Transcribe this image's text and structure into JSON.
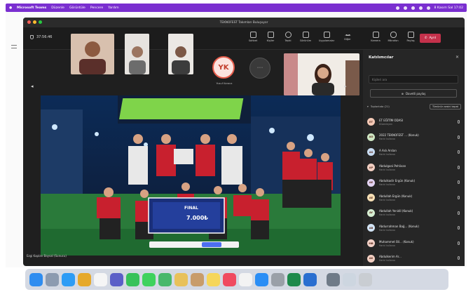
{
  "menubar": {
    "items": [
      "Microsoft Teams",
      "Düzenle",
      "Görüntüle",
      "Pencere",
      "Yardım"
    ],
    "clock": "8 Kasım Sal 17:02"
  },
  "window": {
    "title": "TEKNOFEST Takımları Buluşuyor"
  },
  "toolbar": {
    "timer": "37:56:46",
    "buttons": [
      "Sohbet",
      "Kişiler",
      "Tepki",
      "Görünüm",
      "Uygulamalar",
      "Diğer",
      "Kamera",
      "Mikrofon",
      "Paylaş"
    ],
    "leave_label": "Ayrıl"
  },
  "stage": {
    "yk_initials": "YK",
    "yk_name": "Yusuf Karaca",
    "caption": "Ezgi Kaplan Baysal (Sunucu)",
    "banner_line1": "FINAL",
    "banner_line2": "7.000₺"
  },
  "participants": {
    "title": "Katılımcılar",
    "search_placeholder": "Kişileri ara",
    "share_label": "Davetli paylaş",
    "section_label": "Toplantıda (21)",
    "mute_all": "Tümünün sesini kapat",
    "list": [
      {
        "initials": "ET",
        "name": "ET EĞİTİM ODASI",
        "role": "Düzenleyen",
        "color": "#f4c9b6"
      },
      {
        "initials": "AO",
        "name": "2022 TEKNOFEST ... (Konuk)",
        "role": "Harici kullanıcı",
        "color": "#cfe7c4"
      },
      {
        "initials": "AS",
        "name": "A Aslı Arslan",
        "role": "Harici kullanıcı",
        "color": "#c9dcf2"
      },
      {
        "initials": "AP",
        "name": "Abdulgani Pehlivan",
        "role": "Harici kullanıcı",
        "color": "#f2cfc2"
      },
      {
        "initials": "AE",
        "name": "Abdulkadir Ergün (Konuk)",
        "role": "Harici kullanıcı",
        "color": "#e3d3f2"
      },
      {
        "initials": "AE",
        "name": "Abdullah Ergün (Konuk)",
        "role": "Harici kullanıcı",
        "color": "#f7e0b5"
      },
      {
        "initials": "AY",
        "name": "Abdullah Yenidil (Konuk)",
        "role": "Harici kullanıcı",
        "color": "#d6eed2"
      },
      {
        "initials": "AB",
        "name": "Abdurrahman Bağ... (Konuk)",
        "role": "Harici kullanıcı",
        "color": "#d2e4f5"
      },
      {
        "initials": "MB",
        "name": "Muhammet Bil... (Konuk)",
        "role": "Harici kullanıcı",
        "color": "#f3d2c8"
      },
      {
        "initials": "AK",
        "name": "Abdulkerim Ar...",
        "role": "Harici kullanıcı",
        "color": "#f2cfc2"
      }
    ]
  },
  "dock": {
    "icons": [
      {
        "name": "finder-icon",
        "color": "#2f8df0"
      },
      {
        "name": "launchpad-icon",
        "color": "#8c9bb0"
      },
      {
        "name": "safari-icon",
        "color": "#2d9cf5"
      },
      {
        "name": "chrome-icon",
        "color": "#e6a92b"
      },
      {
        "name": "calendar-icon",
        "color": "#f5f5f5"
      },
      {
        "name": "teams-icon",
        "color": "#5b5fc7"
      },
      {
        "name": "facetime-icon",
        "color": "#38c25a"
      },
      {
        "name": "messages-icon",
        "color": "#3fd25d"
      },
      {
        "name": "maps-icon",
        "color": "#48b86b"
      },
      {
        "name": "photos-icon",
        "color": "#e8c15a"
      },
      {
        "name": "contacts-icon",
        "color": "#c89c6a"
      },
      {
        "name": "notes-icon",
        "color": "#f6d65a"
      },
      {
        "name": "music-icon",
        "color": "#f04a5f"
      },
      {
        "name": "freeform-icon",
        "color": "#f3f3f3"
      },
      {
        "name": "appstore-icon",
        "color": "#2b8ef5"
      },
      {
        "name": "settings-icon",
        "color": "#9aa0a8"
      },
      {
        "name": "excel-icon",
        "color": "#1e8a4c"
      },
      {
        "name": "outlook-icon",
        "color": "#2a6fd0"
      },
      {
        "name": "preview-icon",
        "color": "#6f7b88"
      },
      {
        "name": "downloads-icon",
        "color": "#cdd6e0"
      },
      {
        "name": "trash-icon",
        "color": "#c9cdd2"
      }
    ]
  }
}
